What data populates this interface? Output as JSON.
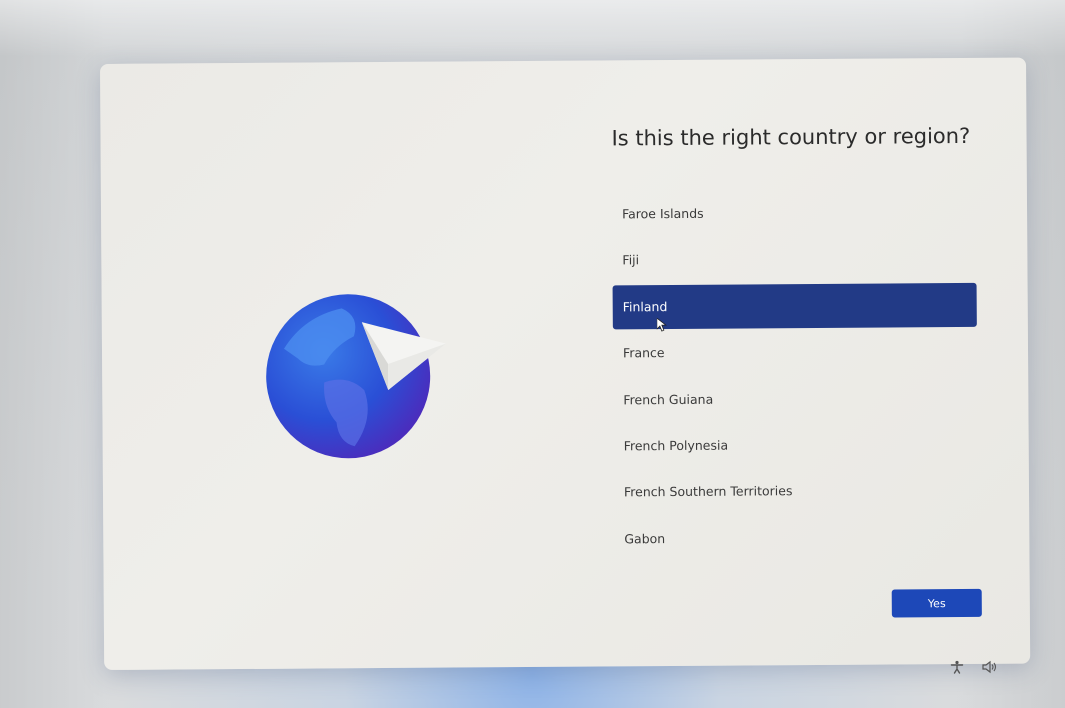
{
  "title": "Is this the right country or region?",
  "countries": [
    {
      "label": "Faroe Islands",
      "selected": false
    },
    {
      "label": "Fiji",
      "selected": false
    },
    {
      "label": "Finland",
      "selected": true
    },
    {
      "label": "France",
      "selected": false
    },
    {
      "label": "French Guiana",
      "selected": false
    },
    {
      "label": "French Polynesia",
      "selected": false
    },
    {
      "label": "French Southern Territories",
      "selected": false
    },
    {
      "label": "Gabon",
      "selected": false
    }
  ],
  "yes_button": {
    "label": "Yes"
  },
  "tray": {
    "icons": [
      "accessibility-icon",
      "volume-icon"
    ]
  },
  "colors": {
    "selected_row": "#223a86",
    "accent_button": "#1d48b8",
    "globe_blue": "#2a4fd6",
    "card_bg": "#ecebe7"
  }
}
